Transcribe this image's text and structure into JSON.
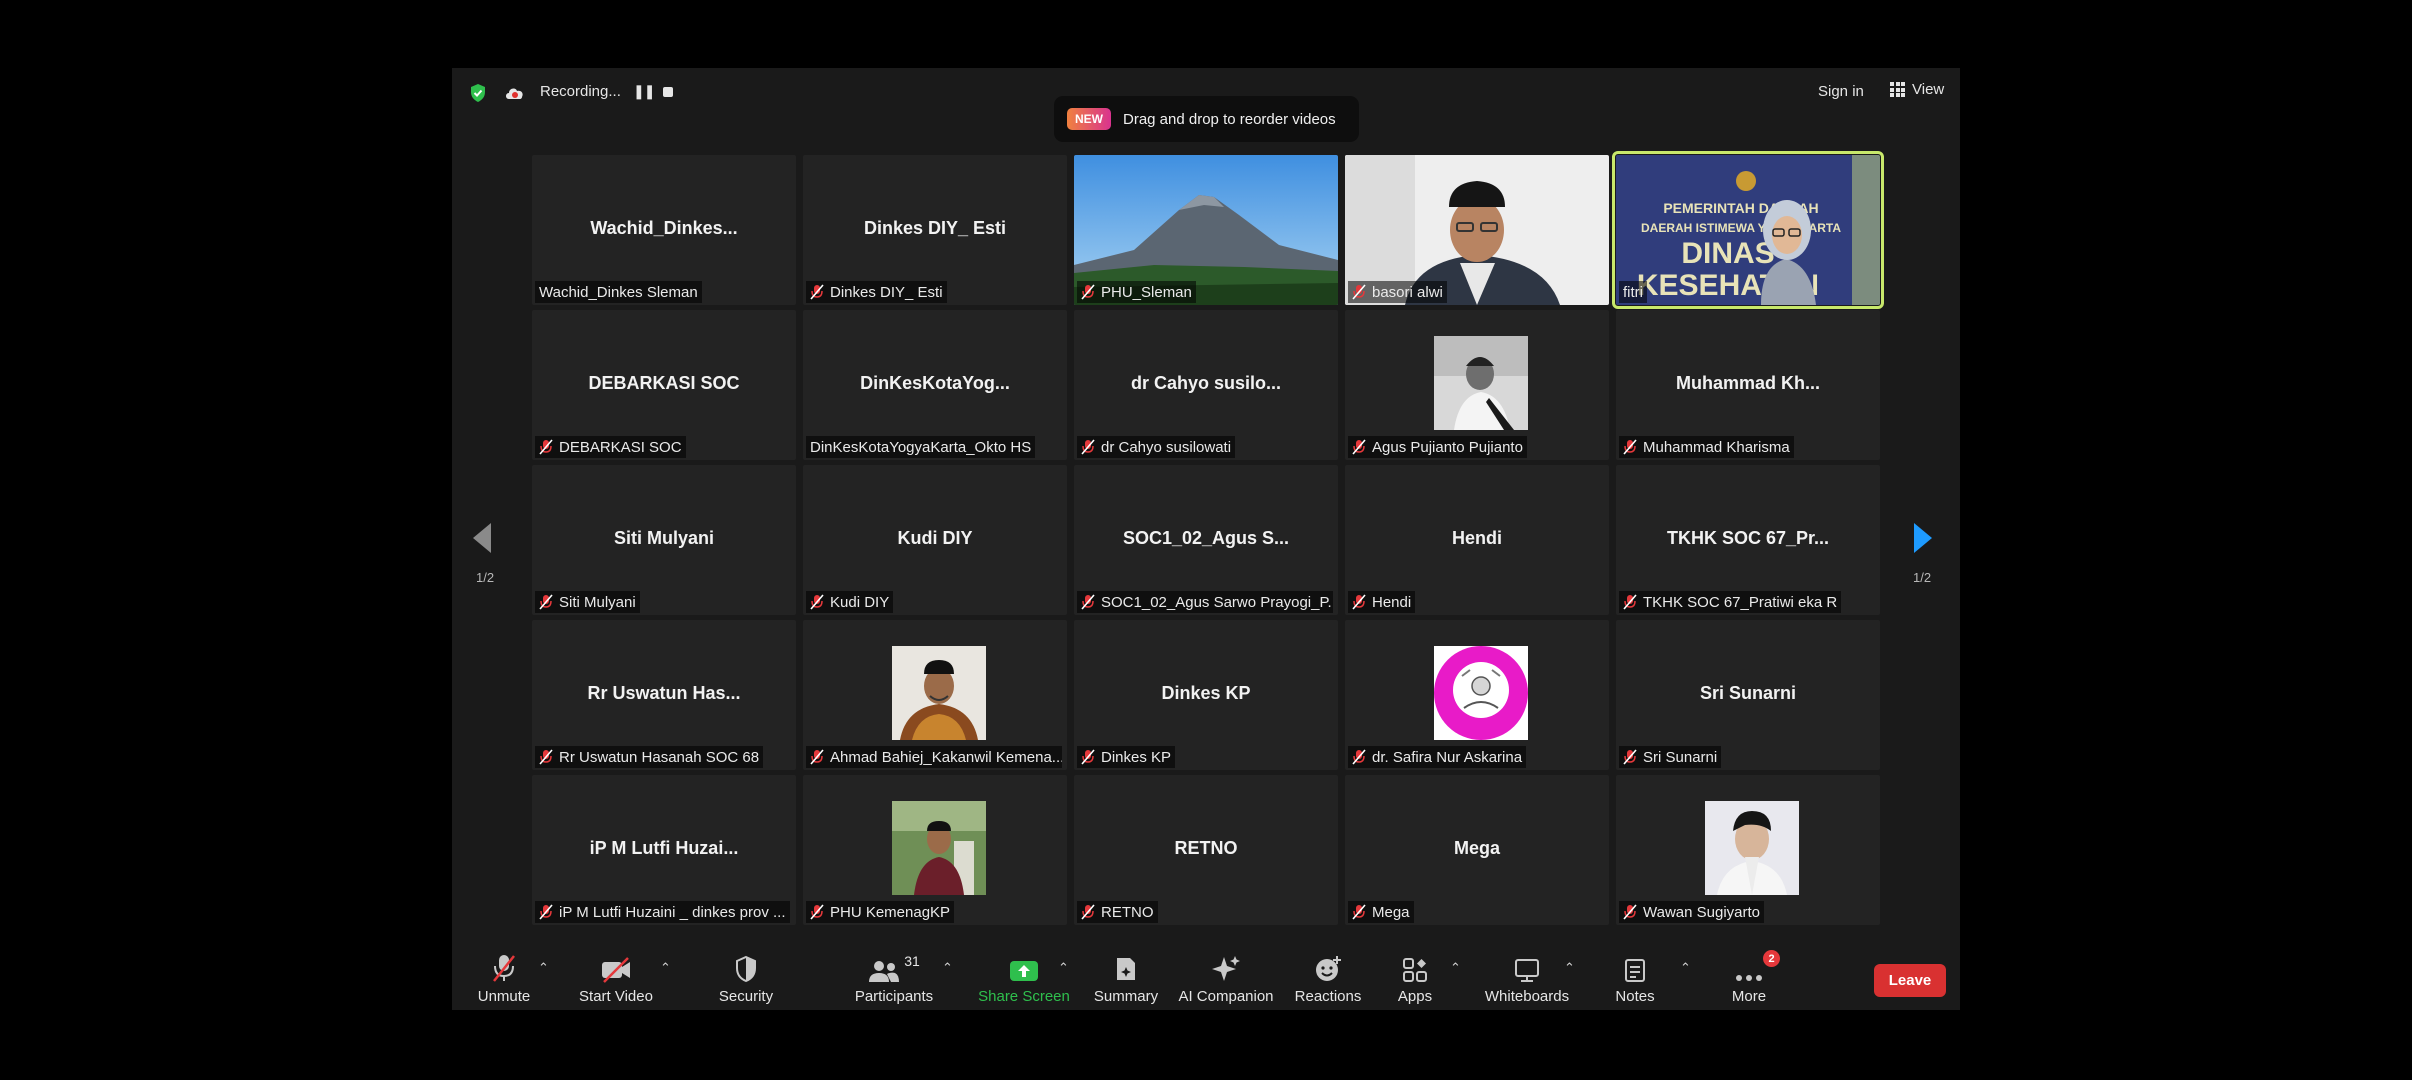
{
  "topbar": {
    "recording_text": "Recording...",
    "sign_in": "Sign in",
    "view": "View",
    "banner_badge": "NEW",
    "banner_text": "Drag and drop to reorder videos"
  },
  "pagination": {
    "left": "1/2",
    "right": "1/2"
  },
  "tiles": [
    {
      "big": "Wachid_Dinkes...",
      "label": "Wachid_Dinkes Sleman",
      "muted": false
    },
    {
      "big": "Dinkes DIY_ Esti",
      "label": "Dinkes DIY_ Esti",
      "muted": true
    },
    {
      "big": "",
      "label": "PHU_Sleman",
      "muted": true
    },
    {
      "big": "",
      "label": "basori alwi",
      "muted": true
    },
    {
      "big": "",
      "label": "fitri",
      "muted": false
    },
    {
      "big": "DEBARKASI SOC",
      "label": "DEBARKASI SOC",
      "muted": true
    },
    {
      "big": "DinKesKotaYog...",
      "label": "DinKesKotaYogyaKarta_Okto HS",
      "muted": false
    },
    {
      "big": "dr Cahyo susilo...",
      "label": "dr Cahyo susilowati",
      "muted": true
    },
    {
      "big": "",
      "label": "Agus Pujianto Pujianto",
      "muted": true
    },
    {
      "big": "Muhammad Kh...",
      "label": "Muhammad Kharisma",
      "muted": true
    },
    {
      "big": "Siti Mulyani",
      "label": "Siti Mulyani",
      "muted": true
    },
    {
      "big": "Kudi DIY",
      "label": "Kudi DIY",
      "muted": true
    },
    {
      "big": "SOC1_02_Agus S...",
      "label": "SOC1_02_Agus Sarwo Prayogi_P...",
      "muted": true
    },
    {
      "big": "Hendi",
      "label": "Hendi",
      "muted": true
    },
    {
      "big": "TKHK SOC 67_Pr...",
      "label": "TKHK SOC 67_Pratiwi eka R",
      "muted": true
    },
    {
      "big": "Rr Uswatun Has...",
      "label": "Rr Uswatun Hasanah SOC 68",
      "muted": true
    },
    {
      "big": "",
      "label": "Ahmad Bahiej_Kakanwil Kemena...",
      "muted": true
    },
    {
      "big": "Dinkes KP",
      "label": "Dinkes KP",
      "muted": true
    },
    {
      "big": "",
      "label": "dr. Safira Nur Askarina",
      "muted": true
    },
    {
      "big": "Sri Sunarni",
      "label": "Sri Sunarni",
      "muted": true
    },
    {
      "big": "iP M Lutfi Huzai...",
      "label": "iP M Lutfi Huzaini _ dinkes prov ...",
      "muted": true
    },
    {
      "big": "",
      "label": "PHU KemenagKP",
      "muted": true
    },
    {
      "big": "RETNO",
      "label": "RETNO",
      "muted": true
    },
    {
      "big": "Mega",
      "label": "Mega",
      "muted": true
    },
    {
      "big": "",
      "label": "Wawan Sugiyarto",
      "muted": true
    }
  ],
  "fitri_sign": {
    "line1": "PEMERINTAH DAERAH",
    "line2": "DAERAH ISTIMEWA YOGYAKARTA",
    "line3": "DINAS",
    "line4": "KESEHATAN"
  },
  "toolbar": {
    "unmute": "Unmute",
    "start_video": "Start Video",
    "security": "Security",
    "participants": "Participants",
    "participants_count": "31",
    "share_screen": "Share Screen",
    "summary": "Summary",
    "ai_companion": "AI Companion",
    "reactions": "Reactions",
    "apps": "Apps",
    "whiteboards": "Whiteboards",
    "notes": "Notes",
    "more": "More",
    "more_badge": "2",
    "leave": "Leave"
  },
  "colors": {
    "share_green": "#2fbf4d",
    "leave_red": "#d93131",
    "active_speaker": "#c8e86b",
    "arrow_blue": "#1e9bff"
  }
}
